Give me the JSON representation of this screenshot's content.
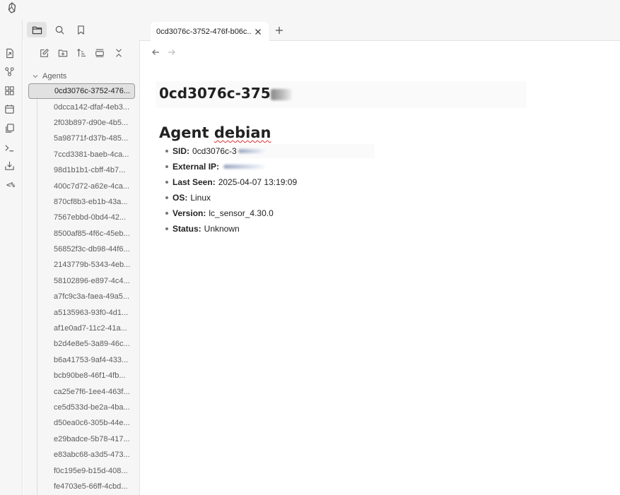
{
  "app": {
    "logo_icon": "obsidian-logo-icon"
  },
  "ribbon": {
    "items": [
      {
        "name": "open-quick-switcher-icon"
      },
      {
        "name": "graph-view-icon"
      },
      {
        "name": "canvas-icon"
      },
      {
        "name": "daily-note-icon"
      },
      {
        "name": "templates-icon"
      },
      {
        "name": "terminal-icon"
      },
      {
        "name": "import-icon"
      },
      {
        "name": "templater-icon",
        "text": "<%"
      }
    ]
  },
  "sidebar_tabs": [
    {
      "name": "file-explorer-tab",
      "icon": "folder-icon",
      "active": true
    },
    {
      "name": "search-tab",
      "icon": "search-icon",
      "active": false
    },
    {
      "name": "bookmarks-tab",
      "icon": "bookmark-icon",
      "active": false
    }
  ],
  "file_explorer": {
    "nav_buttons": [
      {
        "name": "new-note-button",
        "icon": "new-note-icon"
      },
      {
        "name": "new-folder-button",
        "icon": "new-folder-icon"
      },
      {
        "name": "sort-button",
        "icon": "sort-icon"
      },
      {
        "name": "auto-reveal-button",
        "icon": "reveal-icon"
      },
      {
        "name": "collapse-all-button",
        "icon": "collapse-icon"
      }
    ],
    "folder": "Agents",
    "files": [
      "0cd3076c-3752-476...",
      "0dcca142-dfaf-4eb3...",
      "2f03b897-d90e-4b5...",
      "5a98771f-d37b-485...",
      "7ccd3381-baeb-4ca...",
      "98d1b1b1-cbff-4b7...",
      "400c7d72-a62e-4ca...",
      "870cf8b3-eb1b-43a...",
      "7567ebbd-0bd4-42...",
      "8500af85-4f6c-45eb...",
      "56852f3c-db98-44f6...",
      "2143779b-5343-4eb...",
      "58102896-e897-4c4...",
      "a7fc9c3a-faea-49a5...",
      "a5135963-93f0-4d1...",
      "af1e0ad7-11c2-41a...",
      "b2d4e8e5-3a89-46c...",
      "b6a41753-9af4-433...",
      "bcb90be8-46f1-4fb...",
      "ca25e7f6-1ee4-463f...",
      "ce5d533d-be2a-4ba...",
      "d50ea0c6-305b-44e...",
      "e29badce-5b78-417...",
      "e83abc68-a3d5-473...",
      "f0c195e9-b15d-408...",
      "fe4703e5-66ff-4cbd..."
    ],
    "active_index": 0
  },
  "tabbar": {
    "active_tab_title": "0cd3076c-3752-476f-b06c...",
    "close_icon": "close-icon",
    "new_tab_icon": "plus-icon"
  },
  "note": {
    "inline_title": "0cd3076c-375",
    "heading_prefix": "Agent ",
    "heading_word": "debian",
    "properties": [
      {
        "key": "SID:",
        "value": "0cd3076c-3"
      },
      {
        "key": "External IP:",
        "value": ""
      },
      {
        "key": "Last Seen:",
        "value": "2025-04-07 13:19:09"
      },
      {
        "key": "OS:",
        "value": "Linux"
      },
      {
        "key": "Version:",
        "value": "lc_sensor_4.30.0"
      },
      {
        "key": "Status:",
        "value": "Unknown"
      }
    ]
  }
}
